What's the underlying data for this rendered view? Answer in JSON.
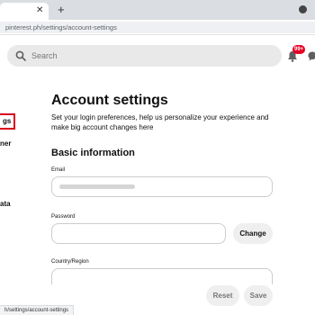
{
  "browser": {
    "new_tab": "+",
    "tab_close": "✕",
    "url": "pinterest.ph/settings/account-settings"
  },
  "header": {
    "search_placeholder": "Search",
    "notification_count": "99+"
  },
  "sidebar": {
    "items": [
      {
        "label": "gs",
        "active": true
      },
      {
        "label": "ner",
        "active": false
      },
      {
        "label": "ata",
        "active": false
      }
    ]
  },
  "main": {
    "title": "Account settings",
    "subtitle": "Set your login preferences, help us personalize your experience and make big account changes here",
    "section_title": "Basic information",
    "email_label": "Email",
    "password_label": "Password",
    "change_button": "Change",
    "country_label": "Country/Region"
  },
  "footer": {
    "reset_button": "Reset",
    "save_button": "Save"
  },
  "status_bar": {
    "link_url": "h/settings/account-settings"
  },
  "colors": {
    "accent": "#e60023",
    "highlight_box": "#d9001b"
  },
  "icons": [
    "close-icon",
    "new-tab-icon",
    "tabs-menu-icon",
    "search-icon",
    "bell-icon",
    "messages-icon"
  ]
}
